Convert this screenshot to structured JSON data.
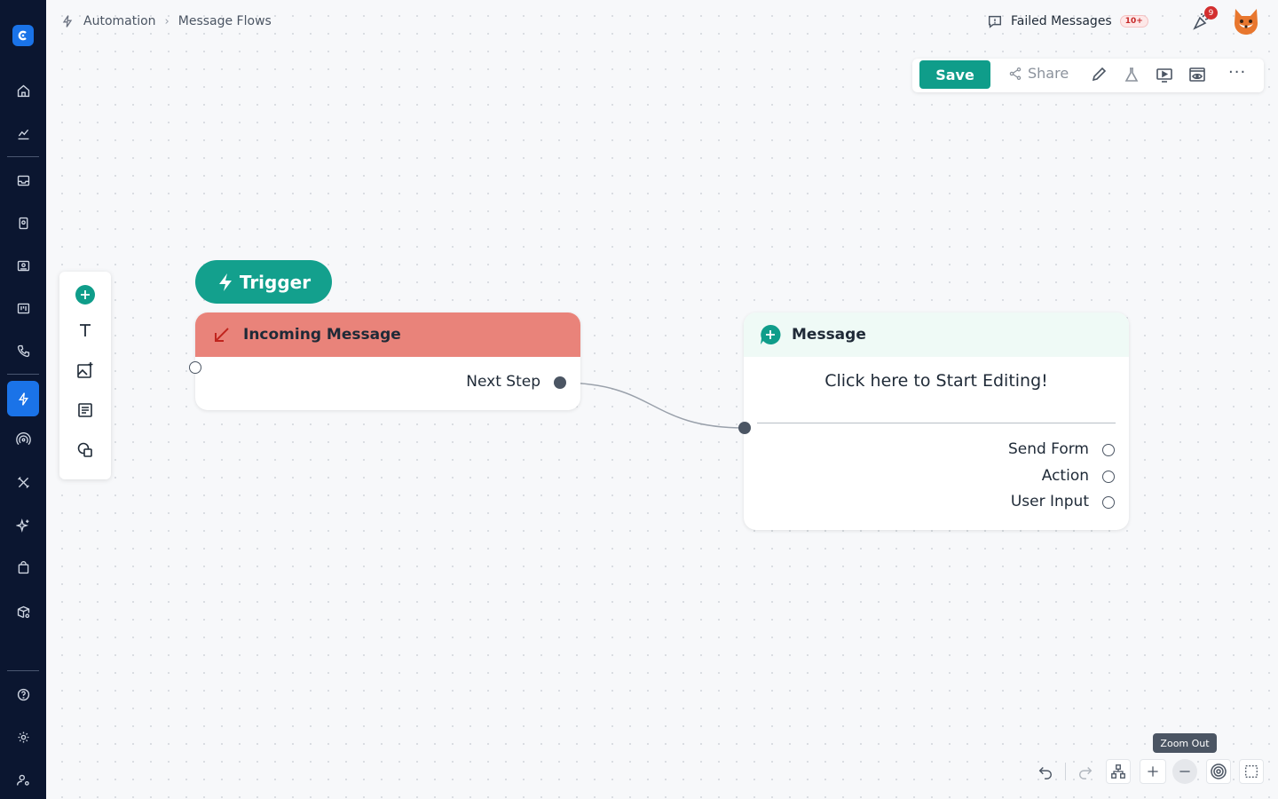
{
  "breadcrumb": {
    "root": "Automation",
    "current": "Message Flows"
  },
  "header": {
    "failed_label": "Failed Messages",
    "failed_count": "10+",
    "notif_count": "9"
  },
  "toolbar": {
    "save_label": "Save",
    "share_label": "Share"
  },
  "nodes": {
    "trigger_label": "Trigger",
    "incoming": {
      "title": "Incoming Message",
      "next_step": "Next Step"
    },
    "message": {
      "title": "Message",
      "body": "Click here to Start Editing!",
      "options": [
        "Send Form",
        "Action",
        "User Input"
      ]
    }
  },
  "controls": {
    "tooltip": "Zoom Out"
  },
  "colors": {
    "accent": "#0f9d8a",
    "nav_bg": "#0b1630",
    "nav_active": "#1a73e8",
    "incoming_head": "#e9837a",
    "message_head": "#effaf6"
  }
}
